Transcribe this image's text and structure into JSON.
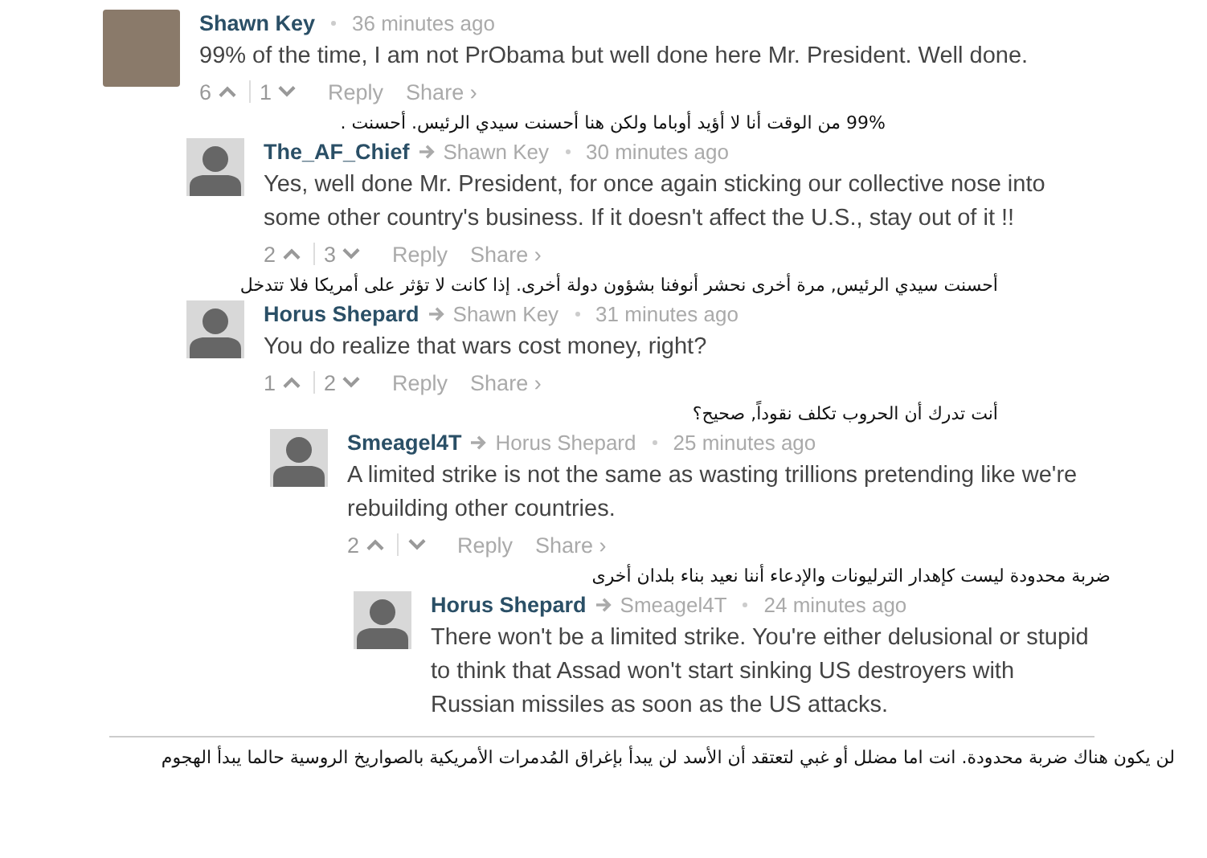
{
  "comments": [
    {
      "kind": "photo",
      "author": "Shawn Key",
      "time": "36 minutes ago",
      "text": "99% of the time, I am not PrObama but well done here Mr. President. Well done.",
      "actions": {
        "up": "6",
        "down": "1",
        "reply": "Reply",
        "share": "Share ›"
      },
      "translation": "99% من الوقت أنا لا أؤيد أوباما ولكن هنا أحسنت سيدي الرئيس. أحسنت .",
      "children": [
        {
          "kind": "silhouette",
          "author": "The_AF_Chief",
          "reply_to": "Shawn Key",
          "time": "30 minutes ago",
          "text": "Yes, well done Mr. President, for once again sticking our collective nose into some other country's business. If it doesn't affect the U.S., stay out of it !!",
          "actions": {
            "up": "2",
            "down": "3",
            "reply": "Reply",
            "share": "Share ›"
          },
          "translation": "أحسنت سيدي الرئيس, مرة أخرى نحشر أنوفنا بشؤون دولة أخرى. إذا كانت لا تؤثر على أمريكا فلا تتدخل"
        },
        {
          "kind": "silhouette",
          "author": "Horus Shepard",
          "reply_to": "Shawn Key",
          "time": "31 minutes ago",
          "text": "You do realize that wars cost money, right?",
          "actions": {
            "up": "1",
            "down": "2",
            "reply": "Reply",
            "share": "Share ›"
          },
          "translation": "أنت تدرك أن الحروب تكلف نقوداً, صحيح؟",
          "children": [
            {
              "kind": "silhouette",
              "author": "Smeagel4T",
              "reply_to": "Horus Shepard",
              "time": "25 minutes ago",
              "text": "A limited strike is not the same as wasting trillions pretending like we're rebuilding other countries.",
              "actions": {
                "up": "2",
                "reply": "Reply",
                "share": "Share ›"
              },
              "translation": "ضربة محدودة ليست كإهدار الترليونات والإدعاء أننا نعيد بناء بلدان أخرى",
              "children": [
                {
                  "kind": "silhouette",
                  "author": "Horus Shepard",
                  "reply_to": "Smeagel4T",
                  "time": "24 minutes ago",
                  "text": "There won't be a limited strike. You're either delusional or stupid to think that Assad won't start sinking US destroyers with Russian missiles as soon as the US attacks.",
                  "translation": "لن يكون هناك ضربة محدودة. انت اما مضلل أو غبي لتعتقد أن الأسد لن يبدأ بإغراق المُدمرات الأمريكية بالصواريخ الروسية حالما يبدأ الهجوم"
                }
              ]
            }
          ]
        }
      ]
    }
  ]
}
